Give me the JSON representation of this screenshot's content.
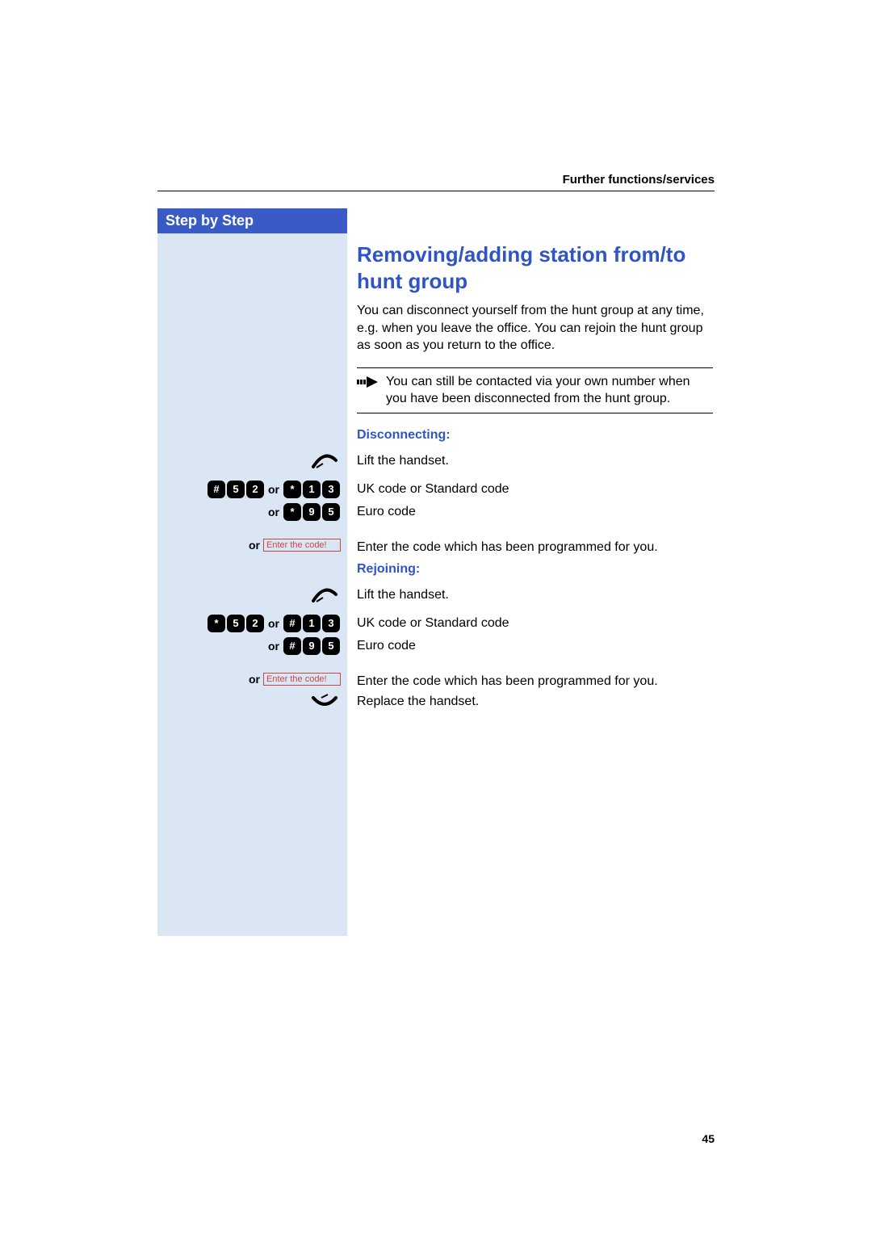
{
  "header": {
    "section": "Further functions/services"
  },
  "sidebar": {
    "title": "Step by Step"
  },
  "labels": {
    "or": "or",
    "enter_code": "Enter the code!"
  },
  "main": {
    "title": "Removing/adding station from/to hunt group",
    "intro": "You can disconnect yourself from the hunt group at any time, e.g. when you leave the office. You can rejoin the hunt group as soon as you return to the office.",
    "note": "You can still be contacted via your own number when you have been disconnected from the hunt group.",
    "disconnecting": {
      "heading": "Disconnecting:",
      "lift": "Lift the handset.",
      "code_line1": "UK code or Standard code",
      "code_line2": "Euro code",
      "enter_text": "Enter the code which has been programmed for you."
    },
    "rejoining": {
      "heading": "Rejoining:",
      "lift": "Lift the handset.",
      "code_line1": "UK code or Standard code",
      "code_line2": "Euro code",
      "enter_text": "Enter the code which has been programmed for you.",
      "replace": "Replace the handset."
    }
  },
  "keys": {
    "hash": "#",
    "star": "*",
    "d1": "1",
    "d2": "2",
    "d3": "3",
    "d5": "5",
    "d9": "9"
  },
  "page_number": "45"
}
